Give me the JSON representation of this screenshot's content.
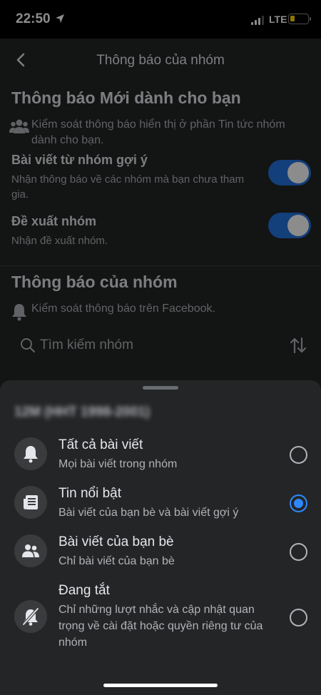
{
  "status_bar": {
    "time": "22:50",
    "network": "LTE",
    "battery_level": 0.2,
    "battery_color": "#ffd60a"
  },
  "nav": {
    "title": "Thông báo của nhóm",
    "back_icon": "chevron-left-icon"
  },
  "new_notifications": {
    "title": "Thông báo Mới dành cho bạn",
    "description": "Kiểm soát thông báo hiển thị ở phần Tin tức nhóm dành cho bạn.",
    "icon": "group-icon",
    "settings": [
      {
        "label": "Bài viết từ nhóm gợi ý",
        "description": "Nhận thông báo về các nhóm mà bạn chưa tham gia.",
        "enabled": true
      },
      {
        "label": "Đề xuất nhóm",
        "description": "Nhận đề xuất nhóm.",
        "enabled": true
      }
    ]
  },
  "group_notifications": {
    "title": "Thông báo của nhóm",
    "description": "Kiểm soát thông báo trên Facebook.",
    "icon": "bell-icon"
  },
  "search": {
    "placeholder": "Tìm kiếm nhóm",
    "icon": "search-icon",
    "sort_icon": "sort-icon"
  },
  "sheet": {
    "group_name": "12M (HHT 1998-2001)",
    "options": [
      {
        "title": "Tất cả bài viết",
        "subtitle": "Mọi bài viết trong nhóm",
        "icon": "bell-icon",
        "selected": false
      },
      {
        "title": "Tin nổi bật",
        "subtitle": "Bài viết của bạn bè và bài viết gợi ý",
        "icon": "newspaper-icon",
        "selected": true
      },
      {
        "title": "Bài viết của bạn bè",
        "subtitle": "Chỉ bài viết của bạn bè",
        "icon": "friends-icon",
        "selected": false
      },
      {
        "title": "Đang tắt",
        "subtitle": "Chỉ những lượt nhắc và cập nhật quan trọng về cài đặt hoặc quyền riêng tư của nhóm",
        "icon": "bell-off-icon",
        "selected": false
      }
    ]
  },
  "colors": {
    "accent": "#2d88ff",
    "toggle_on": "#2374e1",
    "sheet_bg": "#242526"
  }
}
